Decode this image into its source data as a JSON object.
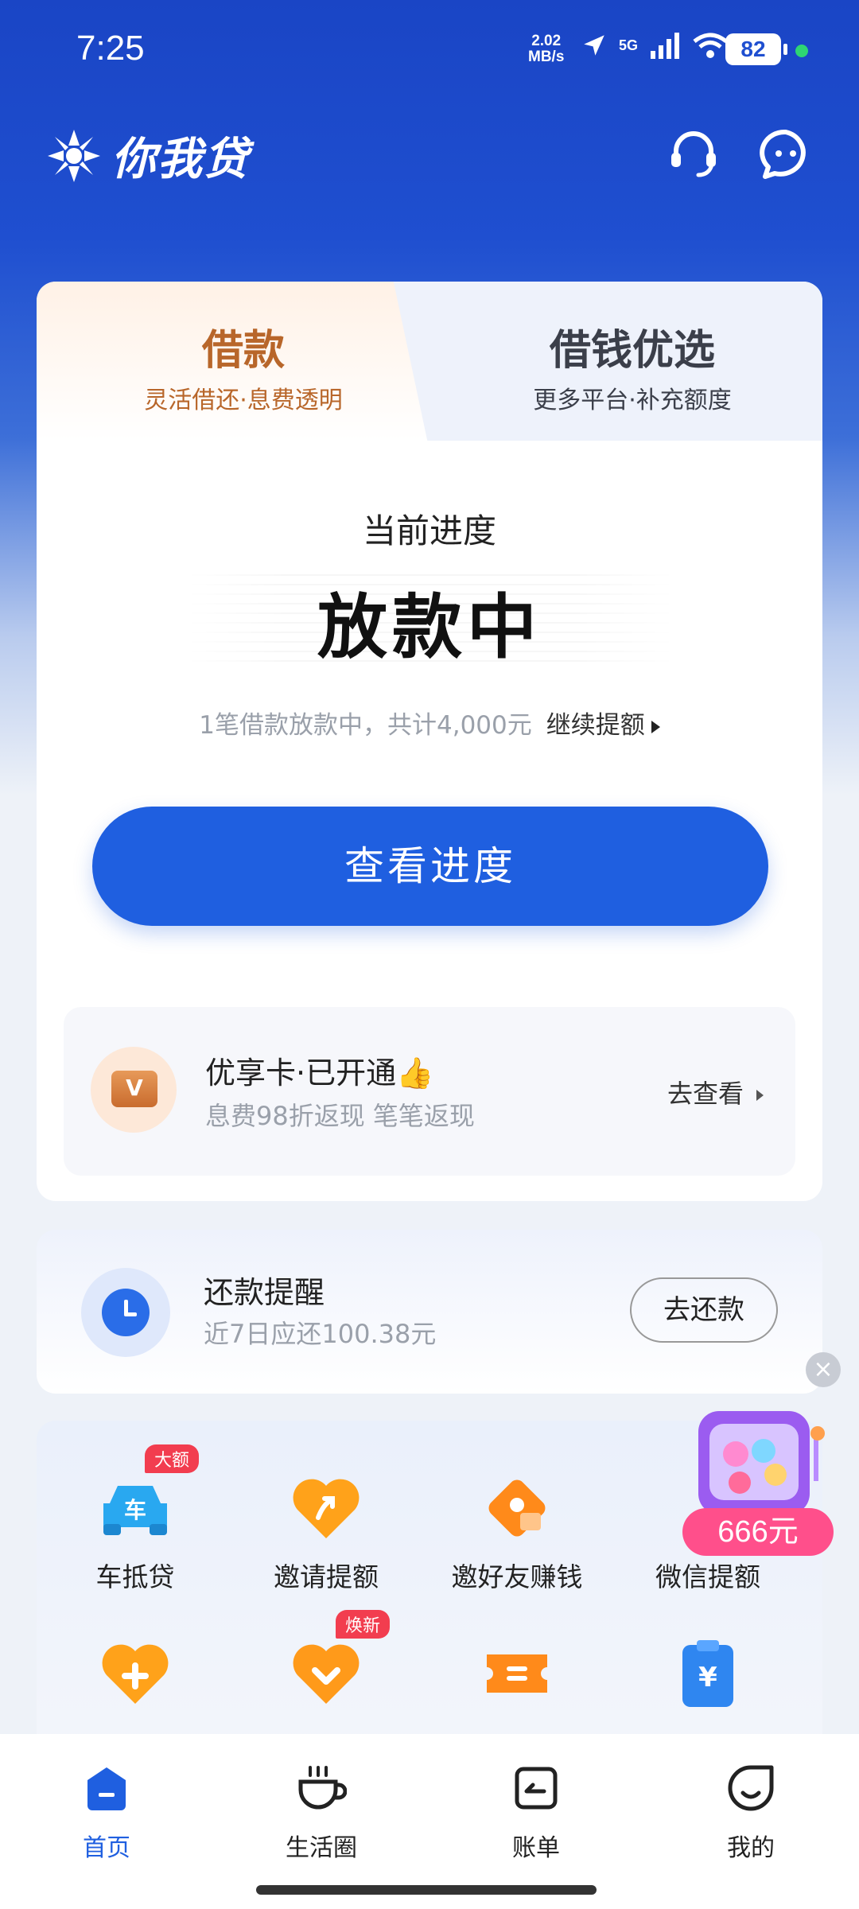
{
  "status_bar": {
    "time": "7:25",
    "net_speed": "2.02",
    "net_unit": "MB/s",
    "signal": "5G",
    "battery": "82"
  },
  "header": {
    "app_name": "你我贷",
    "customer_service_icon": "headset-icon",
    "message_icon": "chat-bubble-icon"
  },
  "tabs": [
    {
      "title": "借款",
      "subtitle": "灵活借还·息费透明",
      "active": true
    },
    {
      "title": "借钱优选",
      "subtitle": "更多平台·补充额度",
      "active": false
    }
  ],
  "progress": {
    "label": "当前进度",
    "status": "放款中",
    "summary": "1笔借款放款中，共计4,000元",
    "link": "继续提额"
  },
  "cta": {
    "label": "查看进度"
  },
  "membership": {
    "icon_letter": "V",
    "title": "优享卡·已开通👍",
    "subtitle": "息费98折返现 笔笔返现",
    "action": "去查看"
  },
  "repay": {
    "title": "还款提醒",
    "subtitle": "近7日应还100.38元",
    "button": "去还款"
  },
  "services": [
    {
      "label": "车抵贷",
      "badge": "大额",
      "icon": "car-icon",
      "icon_text": "车"
    },
    {
      "label": "邀请提额",
      "badge": "",
      "icon": "heart-arrow-icon"
    },
    {
      "label": "邀好友赚钱",
      "badge": "",
      "icon": "diamond-coin-icon"
    },
    {
      "label": "微信提额",
      "badge": "",
      "icon": "wechat-icon"
    },
    {
      "label": "",
      "badge": "",
      "icon": "heart-plus-icon"
    },
    {
      "label": "",
      "badge": "焕新",
      "icon": "heart-down-icon"
    },
    {
      "label": "",
      "badge": "",
      "icon": "ticket-icon"
    },
    {
      "label": "",
      "badge": "",
      "icon": "clipboard-yuan-icon",
      "icon_text": "¥"
    }
  ],
  "promo": {
    "amount": "666元",
    "close": "×"
  },
  "bottom_nav": [
    {
      "label": "首页",
      "icon": "home-icon",
      "active": true
    },
    {
      "label": "生活圈",
      "icon": "coffee-cup-icon",
      "active": false
    },
    {
      "label": "账单",
      "icon": "bill-icon",
      "active": false
    },
    {
      "label": "我的",
      "icon": "profile-icon",
      "active": false
    }
  ],
  "colors": {
    "primary": "#1f5fe0",
    "header_bg": "#1a45c5",
    "accent_orange": "#b8662a",
    "badge_red": "#f23d4f"
  }
}
